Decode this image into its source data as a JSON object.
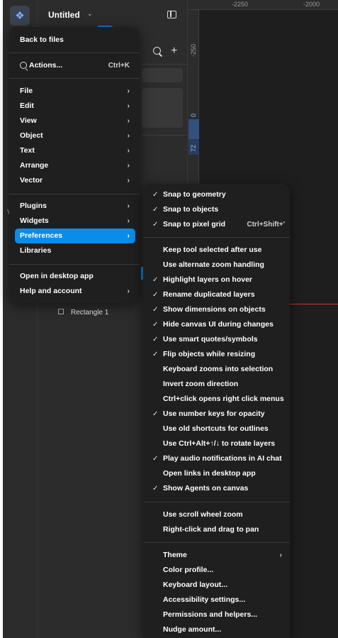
{
  "header": {
    "file_title": "Untitled",
    "chevron_icon": "chevron-down-icon",
    "sidebar_toggle_icon": "sidebar-icon"
  },
  "rail": {
    "logo_icon": "figma-logo-icon",
    "edge_letter": "V"
  },
  "layers": {
    "items": [
      {
        "label": "Rectangle 1",
        "icon": "rectangle-icon"
      }
    ]
  },
  "rulers": {
    "top": [
      "-2250",
      "-2000"
    ],
    "left": [
      "-250",
      "0",
      "72"
    ]
  },
  "main_menu": {
    "back": "Back to files",
    "actions": {
      "label": "Actions...",
      "shortcut": "Ctrl+K",
      "icon": "search-icon"
    },
    "group1": [
      {
        "label": "File",
        "arrow": "›"
      },
      {
        "label": "Edit",
        "arrow": "›"
      },
      {
        "label": "View",
        "arrow": "›"
      },
      {
        "label": "Object",
        "arrow": "›"
      },
      {
        "label": "Text",
        "arrow": "›"
      },
      {
        "label": "Arrange",
        "arrow": "›"
      },
      {
        "label": "Vector",
        "arrow": "›"
      }
    ],
    "group2": [
      {
        "label": "Plugins",
        "arrow": "›"
      },
      {
        "label": "Widgets",
        "arrow": "›"
      },
      {
        "label": "Preferences",
        "arrow": "›",
        "active": true
      },
      {
        "label": "Libraries",
        "arrow": ""
      }
    ],
    "group3": [
      {
        "label": "Open in desktop app",
        "arrow": ""
      },
      {
        "label": "Help and account",
        "arrow": "›"
      }
    ]
  },
  "preferences_menu": {
    "group1": [
      {
        "label": "Snap to geometry",
        "check": "✓",
        "shortcut": ""
      },
      {
        "label": "Snap to objects",
        "check": "✓",
        "shortcut": ""
      },
      {
        "label": "Snap to pixel grid",
        "check": "✓",
        "shortcut": "Ctrl+Shift+'"
      }
    ],
    "group2": [
      {
        "label": "Keep tool selected after use",
        "check": ""
      },
      {
        "label": "Use alternate zoom handling",
        "check": ""
      },
      {
        "label": "Highlight layers on hover",
        "check": "✓"
      },
      {
        "label": "Rename duplicated layers",
        "check": "✓"
      },
      {
        "label": "Show dimensions on objects",
        "check": "✓"
      },
      {
        "label": "Hide canvas UI during changes",
        "check": "✓"
      },
      {
        "label": "Use smart quotes/symbols",
        "check": "✓"
      },
      {
        "label": "Flip objects while resizing",
        "check": "✓"
      },
      {
        "label": "Keyboard zooms into selection",
        "check": ""
      },
      {
        "label": "Invert zoom direction",
        "check": ""
      },
      {
        "label": "Ctrl+click opens right click menus",
        "check": ""
      },
      {
        "label": "Use number keys for opacity",
        "check": "✓"
      },
      {
        "label": "Use old shortcuts for outlines",
        "check": ""
      },
      {
        "label": "Use Ctrl+Alt+↑/↓ to rotate layers",
        "check": ""
      },
      {
        "label": "Play audio notifications in AI chat",
        "check": "✓"
      },
      {
        "label": "Open links in desktop app",
        "check": ""
      },
      {
        "label": "Show Agents on canvas",
        "check": "✓"
      }
    ],
    "group3": [
      {
        "label": "Use scroll wheel zoom",
        "check": ""
      },
      {
        "label": "Right-click and drag to pan",
        "check": ""
      }
    ],
    "group4": [
      {
        "label": "Theme",
        "check": "",
        "arrow": "›"
      },
      {
        "label": "Color profile...",
        "check": "",
        "arrow": ""
      },
      {
        "label": "Keyboard layout...",
        "check": "",
        "arrow": ""
      },
      {
        "label": "Accessibility settings...",
        "check": "",
        "arrow": ""
      },
      {
        "label": "Permissions and helpers...",
        "check": "",
        "arrow": ""
      },
      {
        "label": "Nudge amount...",
        "check": "",
        "arrow": ""
      }
    ]
  },
  "colors": {
    "accent": "#0c8ce9",
    "menu_bg": "#1f1f1f",
    "panel_bg": "#2c2c2c",
    "canvas_bg": "#1e1e1e",
    "ruler_highlight": "#35507a",
    "selection_red": "#c03a2b"
  }
}
